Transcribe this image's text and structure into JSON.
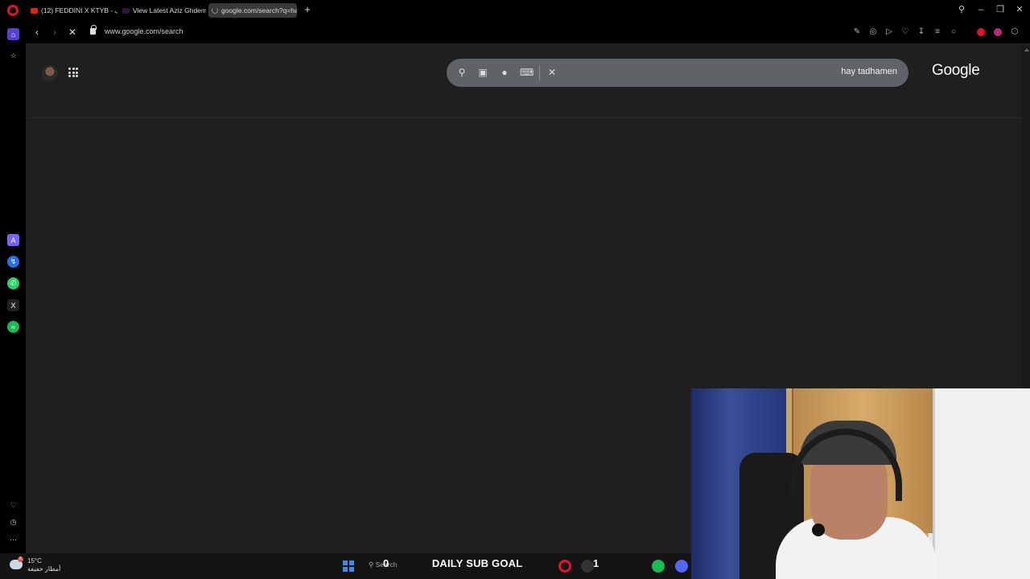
{
  "browser": {
    "tabs": [
      {
        "label": "(12) FEDDINI X KTYB - لايف",
        "active": false
      },
      {
        "label": "View Latest Aziz Ghdemsi",
        "active": false
      },
      {
        "label": "google.com/search?q=ha",
        "active": true
      }
    ],
    "url": "www.google.com/search"
  },
  "google": {
    "query": "hay tadhamen",
    "logo": "Google"
  },
  "taskbar": {
    "temperature": "15°C",
    "weather_desc": "أمطار خفيفة",
    "weather_badge": "6",
    "search_placeholder": "Search",
    "sub_goal_current": "0",
    "sub_goal_label": "DAILY SUB GOAL",
    "sub_goal_target": "1"
  },
  "colors": {
    "opera_red": "#e2142d",
    "page_bg": "#1f1f1f",
    "searchbox_bg": "#5f6368"
  }
}
